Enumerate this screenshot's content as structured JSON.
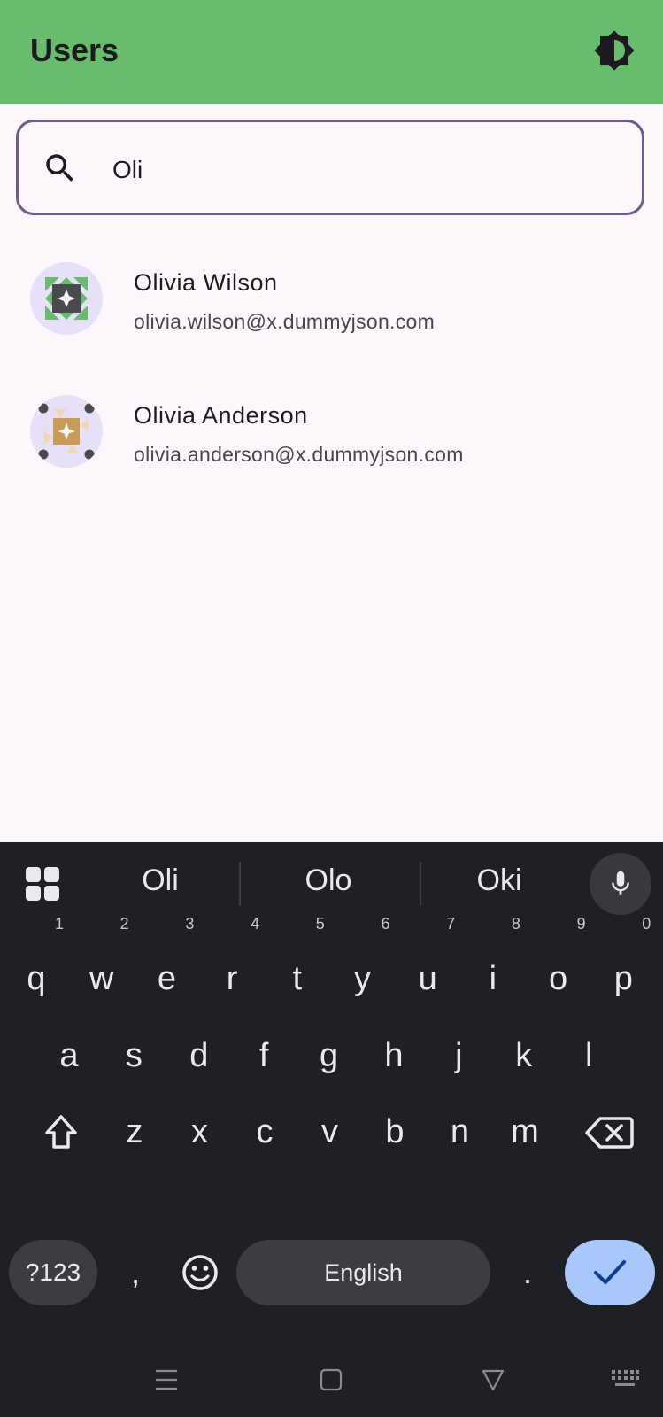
{
  "appbar": {
    "title": "Users",
    "theme_icon": "brightness-icon"
  },
  "search": {
    "icon": "search-icon",
    "value": "Oli"
  },
  "users": [
    {
      "name": "Olivia Wilson",
      "email": "olivia.wilson@x.dummyjson.com"
    },
    {
      "name": "Olivia Anderson",
      "email": "olivia.anderson@x.dummyjson.com"
    }
  ],
  "keyboard": {
    "suggestions": [
      "Oli",
      "Olo",
      "Oki"
    ],
    "row1": [
      {
        "k": "q",
        "h": "1"
      },
      {
        "k": "w",
        "h": "2"
      },
      {
        "k": "e",
        "h": "3"
      },
      {
        "k": "r",
        "h": "4"
      },
      {
        "k": "t",
        "h": "5"
      },
      {
        "k": "y",
        "h": "6"
      },
      {
        "k": "u",
        "h": "7"
      },
      {
        "k": "i",
        "h": "8"
      },
      {
        "k": "o",
        "h": "9"
      },
      {
        "k": "p",
        "h": "0"
      }
    ],
    "row2": [
      "a",
      "s",
      "d",
      "f",
      "g",
      "h",
      "j",
      "k",
      "l"
    ],
    "row3": [
      "z",
      "x",
      "c",
      "v",
      "b",
      "n",
      "m"
    ],
    "symbols_label": "?123",
    "comma": ",",
    "space_label": "English",
    "period": "."
  },
  "colors": {
    "appbar": "#67bd6b",
    "search_border": "#6b5b8f",
    "enter": "#a8c7fa",
    "keyboard_bg": "#1f2023"
  }
}
